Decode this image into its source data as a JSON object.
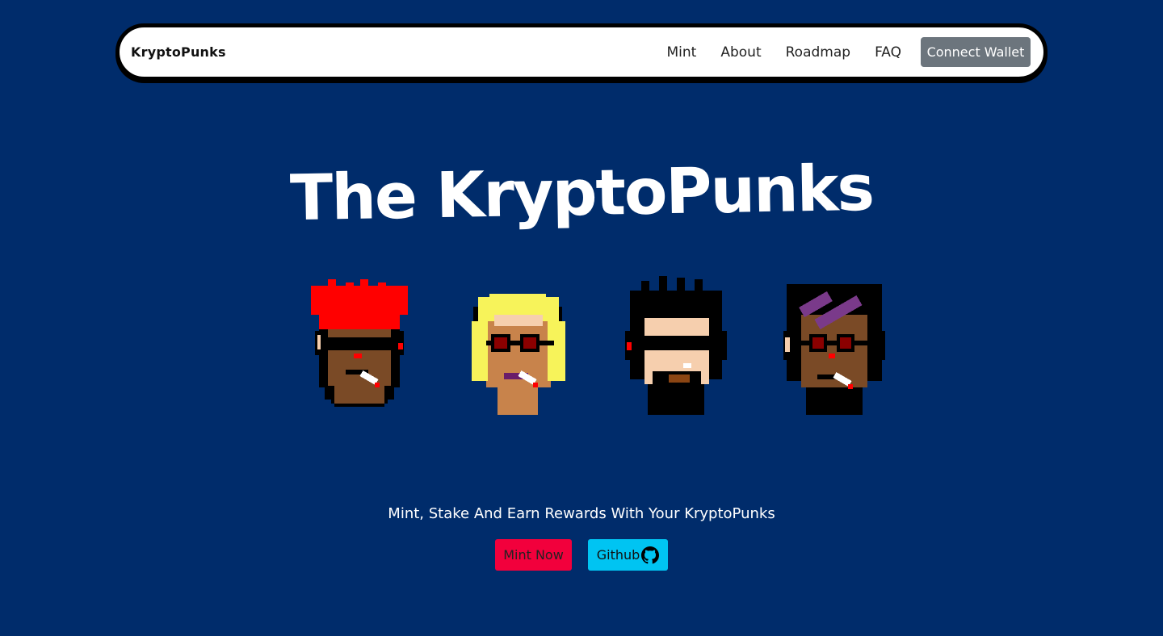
{
  "navbar": {
    "brand": "KryptoPunks",
    "links": [
      "Mint",
      "About",
      "Roadmap",
      "FAQ"
    ],
    "connect_label": "Connect Wallet"
  },
  "hero": {
    "title": "The KryptoPunks",
    "tagline": "Mint, Stake And Earn Rewards With Your KryptoPunks",
    "mint_label": "Mint Now",
    "github_label": "Github",
    "github_icon": "github-icon"
  },
  "colors": {
    "background": "#002c6b",
    "navbar_bg": "#ffffff",
    "connect_btn": "#6c757d",
    "mint_btn": "#f2003c",
    "github_btn": "#00c4f2"
  },
  "punks": [
    {
      "name": "punk-red-hair",
      "skin": "#7a4a26",
      "hair": "#ff0000"
    },
    {
      "name": "punk-blonde",
      "skin": "#c8834b",
      "hair": "#f7f35a"
    },
    {
      "name": "punk-black-hair",
      "skin": "#f6cfae",
      "hair": "#000000"
    },
    {
      "name": "punk-purple-bandana",
      "skin": "#7a4a26",
      "hair": "#000000"
    }
  ]
}
